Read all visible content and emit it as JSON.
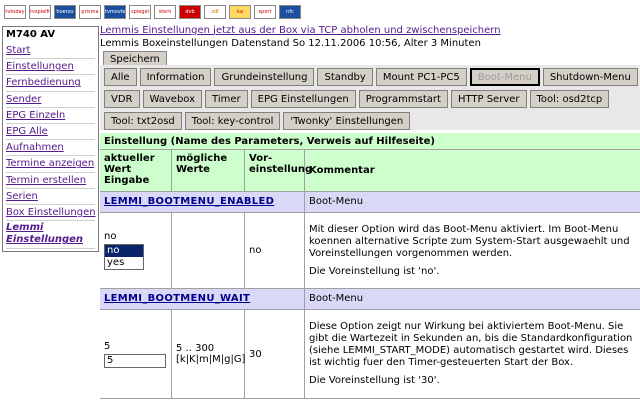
{
  "logos": [
    "tvtoday",
    "tvspielfilm",
    "hoerzu",
    "prisma",
    "tvmovie",
    "spiegel",
    "stern",
    "dvb",
    "zdf",
    "ka",
    "sport",
    "nfc"
  ],
  "nav": {
    "title": "M740 AV",
    "items": [
      "Start",
      "Einstellungen",
      "Fernbedienung",
      "Sender",
      "EPG Einzeln",
      "EPG Alle",
      "Aufnahmen",
      "Termine anzeigen",
      "Termin erstellen",
      "Serien",
      "Box Einstellungen"
    ],
    "active_line1": "Lemmi",
    "active_line2": "Einstellungen"
  },
  "header": {
    "link_prefix": "Lemmis Einstellungen ",
    "link_text": "jetzt aus der Box via TCP abholen und zwischenspeichern",
    "status": "Lemmis Boxeinstellungen Datenstand So 12.11.2006 10:56, Alter 3 Minuten",
    "save_label": "Speichern"
  },
  "buttons": {
    "row1": [
      "Alle",
      "Information",
      "Grundeinstellung",
      "Standby",
      "Mount PC1-PC5",
      "Boot-Menu",
      "Shutdown-Menu"
    ],
    "row2": [
      "VDR",
      "Wavebox",
      "Timer",
      "EPG Einstellungen",
      "Programmstart",
      "HTTP Server",
      "Tool: osd2tcp"
    ],
    "row3": [
      "Tool: txt2osd",
      "Tool: key-control",
      "'Twonky' Einstellungen"
    ]
  },
  "table": {
    "caption": "Einstellung (Name des Parameters, Verweis auf Hilfeseite)",
    "col1": "aktueller Wert Eingabe",
    "col2": "mögliche Werte",
    "col3": "Vor-einstellung",
    "col4": "Kommentar",
    "params": [
      {
        "name": "LEMMI_BOOTMENU_ENABLED",
        "group": "Boot-Menu",
        "current": "no",
        "options": [
          "no",
          "yes"
        ],
        "selected": "no",
        "possible": "",
        "default": "no",
        "comment": "Mit dieser Option wird das Boot-Menu aktiviert. Im Boot-Menu koennen alternative Scripte zum System-Start ausgewaehlt und Voreinstellungen vorgenommen werden.",
        "default_note": "Die Voreinstellung ist 'no'."
      },
      {
        "name": "LEMMI_BOOTMENU_WAIT",
        "group": "Boot-Menu",
        "current": "5",
        "input": "5",
        "possible": "5 .. 300 [k|K|m|M|g|G]",
        "default": "30",
        "comment": "Diese Option zeigt nur Wirkung bei aktiviertem Boot-Menu. Sie gibt die Wartezeit in Sekunden an, bis die Standardkonfiguration (siehe LEMMI_START_MODE) automatisch gestartet wird. Dieses ist wichtig fuer den Timer-gesteuerten Start der Box.",
        "default_note": "Die Voreinstellung ist '30'."
      }
    ]
  }
}
